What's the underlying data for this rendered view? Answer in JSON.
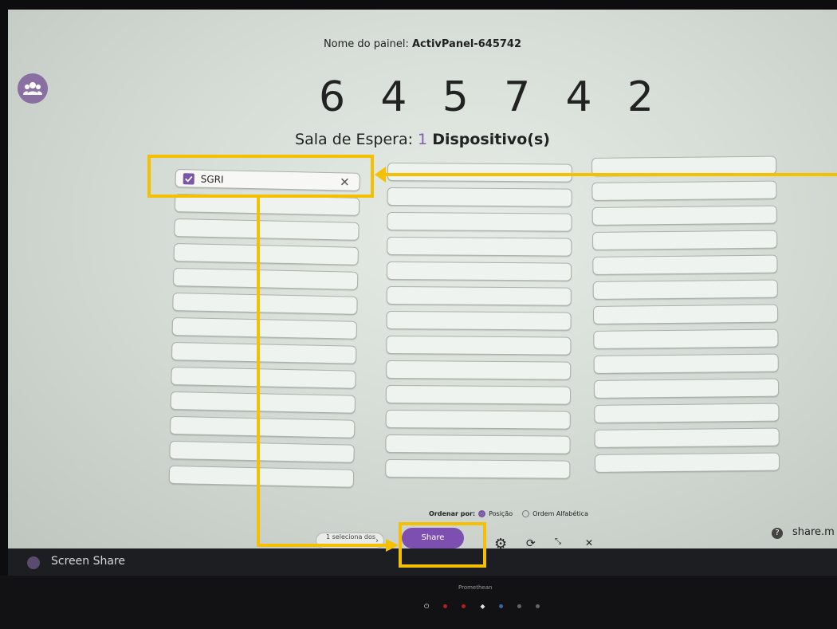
{
  "panel": {
    "name_label": "Nome do painel:",
    "name_value": "ActivPanel-645742",
    "code_digits": [
      "6",
      "4",
      "5",
      "7",
      "4",
      "2"
    ]
  },
  "room": {
    "badge": "1"
  },
  "waiting_room": {
    "prefix": "Sala de Espera:",
    "count": "1",
    "suffix": "Dispositivo(s)"
  },
  "devices": [
    {
      "name": "SGRI",
      "checked": true
    }
  ],
  "sort": {
    "label": "Ordenar por:",
    "options": [
      {
        "label": "Posição",
        "selected": true
      },
      {
        "label": "Ordem Alfabética",
        "selected": false
      }
    ]
  },
  "actions": {
    "selected_count": "1 seleciona dos",
    "share_label": "Share",
    "share_url": "share.m"
  },
  "taskbar": {
    "app_label": "Screen Share"
  },
  "hardware": {
    "brand": "Promethean"
  },
  "colors": {
    "accent": "#7d4fb0",
    "highlight": "#f5c000"
  }
}
